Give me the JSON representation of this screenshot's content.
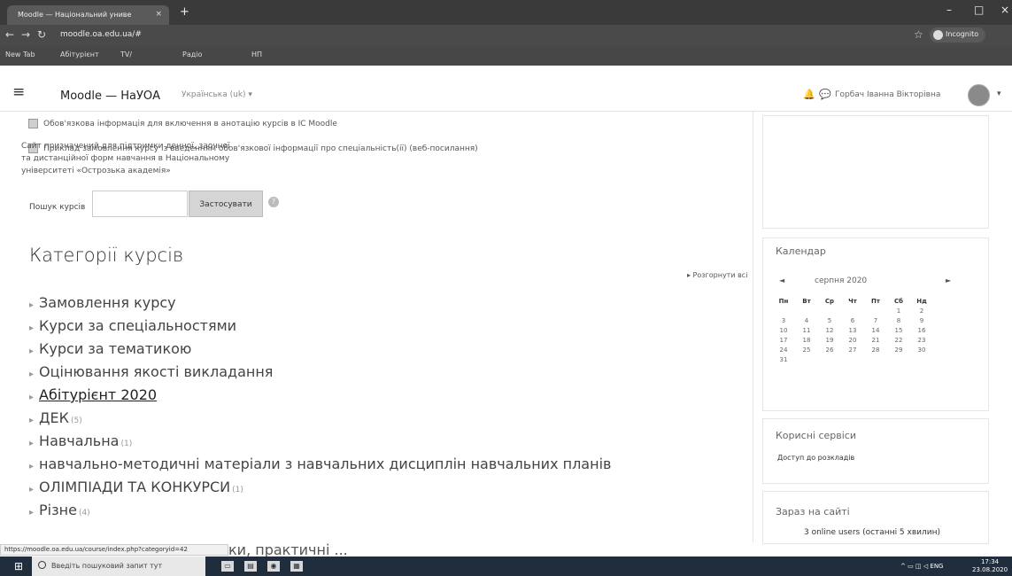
{
  "browser": {
    "tab_title": "Moodle — Національний униве",
    "tab_close": "×",
    "new_tab": "+",
    "window_controls": [
      "–",
      "□",
      "×"
    ],
    "url": "moodle.oa.edu.ua/#",
    "incognito_label": "Incognito",
    "bookmarks": [
      "New Tab",
      "Абітурієнт",
      "TV/",
      "Радіо",
      "НП"
    ]
  },
  "header": {
    "brand": "Moodle — НаУОА",
    "language": "Українська (uk) ▾",
    "user_name": "Горбач Іванна Вікторівна"
  },
  "main": {
    "files": [
      "Обов'язкова інформація для включення в анотацію курсів в ІС Moodle",
      "Приклад замовлення курсу із введенням обов'язкової інформації про спеціальність(ії) (веб-посилання)"
    ],
    "search_label": "Пошук курсів",
    "search_button": "Застосувати",
    "categories_title": "Категорії курсів",
    "expand_all": "▸ Розгорнути всі",
    "categories": [
      {
        "label": "Замовлення курсу",
        "sub": ""
      },
      {
        "label": "Курси за спеціальностями",
        "sub": ""
      },
      {
        "label": "Курси за тематикою",
        "sub": ""
      },
      {
        "label": "Оцінювання якості викладання",
        "sub": ""
      },
      {
        "label": "Абітурієнт 2020",
        "sub": ""
      },
      {
        "label": "ДЕК",
        "sub": "(5)"
      },
      {
        "label": "Навчальна",
        "sub": "(1)"
      },
      {
        "label": "навчально-методичні матеріали з навчальних дисциплін навчальних планів",
        "sub": ""
      },
      {
        "label": "ОЛІМПІАДИ ТА КОНКУРСИ",
        "sub": "(1)"
      },
      {
        "label": "Різне",
        "sub": "(4)"
      }
    ],
    "status_url": "https://moodle.oa.edu.ua/course/index.php?categoryid=42",
    "cut_item": "ки, практичні ..."
  },
  "sidebar": {
    "about": "Сайт призначений для підтримки денної, заочної та дистанційної форм навчання в Національному університеті «Острозька академія»",
    "calendar_title": "Календар",
    "calendar_month": "серпня 2020",
    "calendar_prev": "◄",
    "calendar_next": "►",
    "weekdays": [
      "Пн",
      "Вт",
      "Ср",
      "Чт",
      "Пт",
      "Сб",
      "Нд"
    ],
    "weeks": [
      [
        "",
        "",
        "",
        "",
        "",
        "1",
        "2"
      ],
      [
        "3",
        "4",
        "5",
        "6",
        "7",
        "8",
        "9"
      ],
      [
        "10",
        "11",
        "12",
        "13",
        "14",
        "15",
        "16"
      ],
      [
        "17",
        "18",
        "19",
        "20",
        "21",
        "22",
        "23"
      ],
      [
        "24",
        "25",
        "26",
        "27",
        "28",
        "29",
        "30"
      ],
      [
        "31",
        "",
        "",
        "",
        "",
        "",
        ""
      ]
    ],
    "services_title": "Корисні сервіси",
    "services_link": "Доступ до розкладів",
    "online_title": "Зараз на сайті",
    "online_text": "3 online users (останні 5 хвилин)"
  },
  "taskbar": {
    "search_placeholder": "Введіть пошуковий запит тут",
    "language": "ENG",
    "time": "17:34",
    "date": "23.08.2020"
  }
}
